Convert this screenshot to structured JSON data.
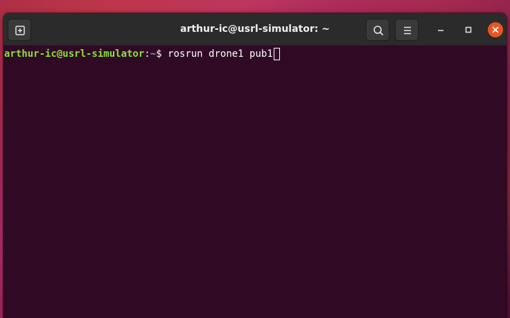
{
  "window": {
    "title": "arthur-ic@usrl-simulator: ~"
  },
  "toolbar": {
    "new_tab_icon": "new-tab-icon",
    "search_icon": "search-icon",
    "menu_icon": "hamburger-menu-icon"
  },
  "window_controls": {
    "minimize_icon": "minimize-icon",
    "maximize_icon": "maximize-icon",
    "close_icon": "close-icon"
  },
  "terminal": {
    "user_host": "arthur-ic@usrl-simulator",
    "separator": ":",
    "path": "~",
    "dollar": "$ ",
    "command": "rosrun drone1 pub1"
  },
  "colors": {
    "terminal_bg": "#300a24",
    "prompt_user": "#8ae234",
    "prompt_path": "#729fcf",
    "close_button": "#e95420",
    "titlebar": "#2b2b2b"
  }
}
